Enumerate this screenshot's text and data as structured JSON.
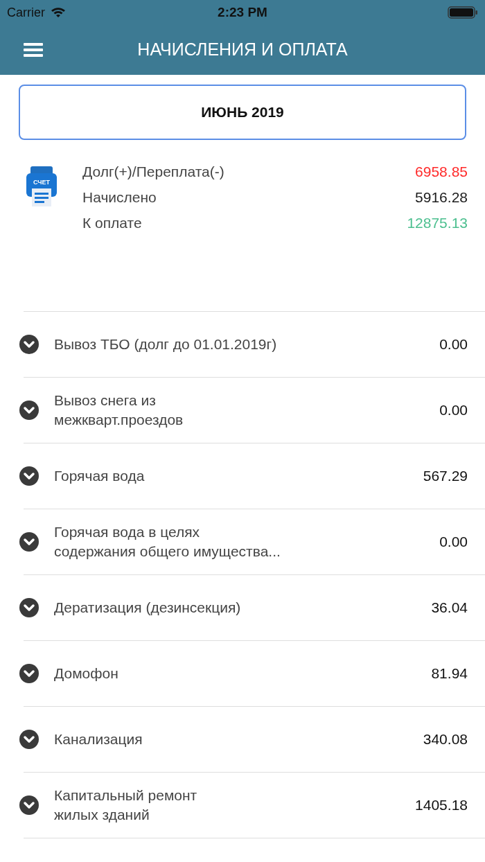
{
  "status_bar": {
    "carrier": "Carrier",
    "time": "2:23 PM"
  },
  "header": {
    "title": "НАЧИСЛЕНИЯ И ОПЛАТА"
  },
  "period_button": {
    "label": "ИЮНЬ 2019"
  },
  "summary": {
    "icon_label": "СЧЕТ",
    "rows": [
      {
        "label": "Долг(+)/Переплата(-)",
        "value": "6958.85",
        "color": "#ff2a2a"
      },
      {
        "label": "Начислено",
        "value": "5916.28",
        "color": "#1c1c1c"
      },
      {
        "label": "К оплате",
        "value": "12875.13",
        "color": "#4cbf8f"
      }
    ]
  },
  "services": [
    {
      "name": "Вывоз ТБО (долг до 01.01.2019г)",
      "amount": "0.00",
      "expanded": false
    },
    {
      "name": "Вывоз снега из\nмежкварт.проездов",
      "amount": "0.00",
      "expanded": false
    },
    {
      "name": "Горячая вода",
      "amount": "567.29",
      "expanded": false
    },
    {
      "name": "Горячая вода в целях\nсодержания общего имущества...",
      "amount": "0.00",
      "expanded": false
    },
    {
      "name": "Дератизация (дезинсекция)",
      "amount": "36.04",
      "expanded": false
    },
    {
      "name": "Домофон",
      "amount": "81.94",
      "expanded": false
    },
    {
      "name": "Канализация",
      "amount": "340.08",
      "expanded": false
    },
    {
      "name": "Капитальный ремонт\nжилых зданий",
      "amount": "1405.18",
      "expanded": false
    }
  ]
}
